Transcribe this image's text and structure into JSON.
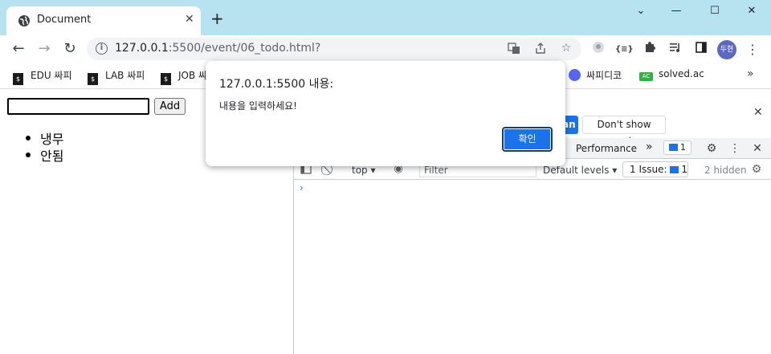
{
  "browser": {
    "tab_title": "Document",
    "tab_close": "✕",
    "new_tab": "+",
    "url_host": "127.0.0.1",
    "url_rest": ":5500/event/06_todo.html?",
    "avatar_text": "두현",
    "extensions": [
      "translate-icon",
      "share-icon",
      "star-icon",
      "profile-ext-icon",
      "json-ext-icon",
      "puzzle-icon",
      "media-icon",
      "sidepanel-icon"
    ],
    "json_ext_label": "{≡}",
    "window_controls": {
      "minimize": "—",
      "maximize": "☐",
      "close": "✕",
      "dropdown": "⌄"
    }
  },
  "bookmarks": [
    {
      "label": "EDU 싸피",
      "icon": "ssafy-icon"
    },
    {
      "label": "LAB 싸피",
      "icon": "ssafy-icon"
    },
    {
      "label": "JOB 싸",
      "icon": "ssafy-icon"
    },
    {
      "label": "싸피디코",
      "icon": "discord-icon"
    },
    {
      "label": "solved.ac",
      "icon": "solvedac-icon"
    }
  ],
  "bookmark_more": "»",
  "page": {
    "input_value": "",
    "add_label": "Add",
    "todos": [
      "냉무",
      "안됨"
    ]
  },
  "devtools": {
    "blue_button_partial": "an",
    "dont_show": "Don't show again",
    "close": "✕",
    "tabs": {
      "performance": "Performance",
      "more": "»"
    },
    "issue_count": "1",
    "console": {
      "context": "top",
      "filter_placeholder": "Filter",
      "levels": "Default levels",
      "issues": "1 Issue:",
      "issues_count": "1",
      "hidden": "2 hidden",
      "prompt": "›"
    }
  },
  "dialog": {
    "title": "127.0.0.1:5500 내용:",
    "message": "내용을 입력하세요!",
    "ok": "확인"
  },
  "colors": {
    "titlebar": "#b7e3f1",
    "accent": "#1a73e8"
  }
}
